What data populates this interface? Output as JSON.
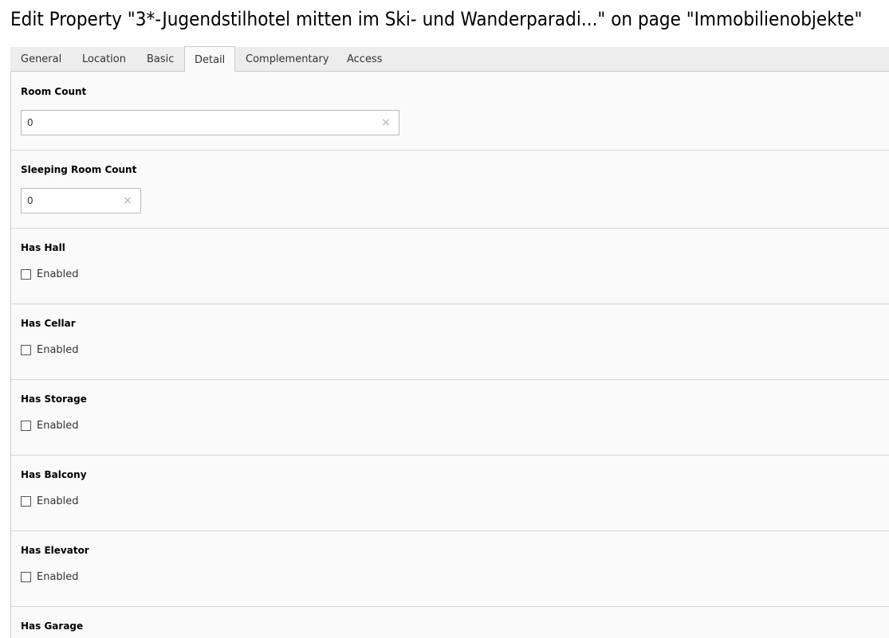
{
  "header": {
    "title": "Edit Property \"3*-Jugendstilhotel mitten im Ski- und Wanderparadi...\" on page \"Immobilienobjekte\""
  },
  "tabs": [
    {
      "label": "General",
      "active": false
    },
    {
      "label": "Location",
      "active": false
    },
    {
      "label": "Basic",
      "active": false
    },
    {
      "label": "Detail",
      "active": true
    },
    {
      "label": "Complementary",
      "active": false
    },
    {
      "label": "Access",
      "active": false
    }
  ],
  "fields": {
    "room_count": {
      "label": "Room Count",
      "value": "0"
    },
    "sleeping_room_count": {
      "label": "Sleeping Room Count",
      "value": "0"
    },
    "has_hall": {
      "label": "Has Hall",
      "checkbox_label": "Enabled",
      "checked": false
    },
    "has_cellar": {
      "label": "Has Cellar",
      "checkbox_label": "Enabled",
      "checked": false
    },
    "has_storage": {
      "label": "Has Storage",
      "checkbox_label": "Enabled",
      "checked": false
    },
    "has_balcony": {
      "label": "Has Balcony",
      "checkbox_label": "Enabled",
      "checked": false
    },
    "has_elevator": {
      "label": "Has Elevator",
      "checkbox_label": "Enabled",
      "checked": false
    },
    "has_garage": {
      "label": "Has Garage"
    }
  },
  "icons": {
    "clear": "×"
  },
  "colors": {
    "panel_background": "#fafafa",
    "tabbar_background": "#ededed",
    "border": "#cccccc"
  }
}
